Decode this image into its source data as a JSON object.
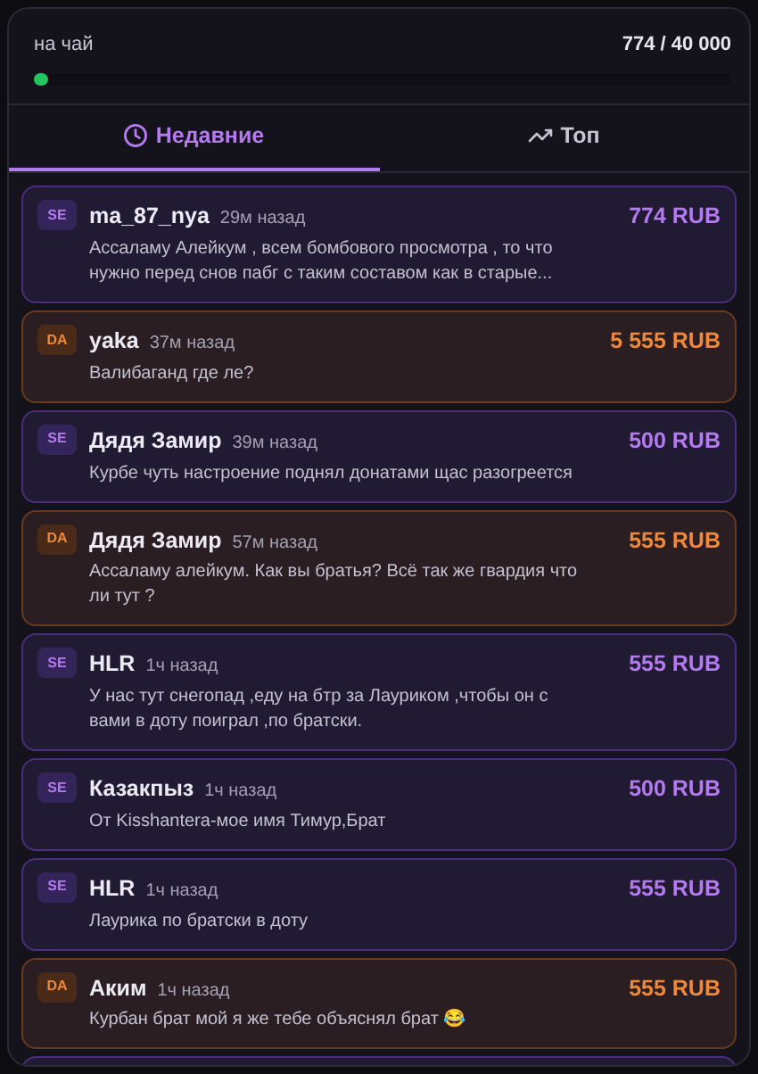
{
  "goal": {
    "title": "на чай",
    "amount": "774 / 40 000",
    "level": 0.02
  },
  "tabs": [
    {
      "label": "Недавние",
      "kind": "clock",
      "selected": true
    },
    {
      "label": "Топ",
      "kind": "trend",
      "selected": false
    }
  ],
  "donations": [
    {
      "kind": "se",
      "source": "SE",
      "name": "ma_87_nya",
      "time": "29м назад",
      "amount": "774 RUB",
      "message": "Ассаламу Алейкум , всем бомбового просмотра , то что нужно перед снов пабг с таким составом как в старые..."
    },
    {
      "kind": "da",
      "source": "DA",
      "name": "yaka",
      "time": "37м назад",
      "amount": "5 555 RUB",
      "message": "Валибаганд где ле?"
    },
    {
      "kind": "se",
      "source": "SE",
      "name": "Дядя Замир",
      "time": "39м назад",
      "amount": "500 RUB",
      "message": "Курбе чуть настроение поднял донатами щас разогреется"
    },
    {
      "kind": "da",
      "source": "DA",
      "name": "Дядя Замир",
      "time": "57м назад",
      "amount": "555 RUB",
      "message": "Ассаламу алейкум. Как вы братья? Всё так же гвардия что ли тут ?"
    },
    {
      "kind": "se",
      "source": "SE",
      "name": "HLR",
      "time": "1ч назад",
      "amount": "555 RUB",
      "message": "У нас тут снегопад ,еду на бтр за Лауриком ,чтобы он с вами в доту поиграл ,по братски."
    },
    {
      "kind": "se",
      "source": "SE",
      "name": "Казакпыз",
      "time": "1ч назад",
      "amount": "500 RUB",
      "message": "От Kisshantera-мое имя Тимур,Брат"
    },
    {
      "kind": "se",
      "source": "SE",
      "name": "HLR",
      "time": "1ч назад",
      "amount": "555 RUB",
      "message": "Лаурика по братски в доту"
    },
    {
      "kind": "da",
      "source": "DA",
      "name": "Аким",
      "time": "1ч назад",
      "amount": "555 RUB",
      "message": "Курбан брат мой я же тебе объяснял брат 😂"
    },
    {
      "kind": "se"
    }
  ]
}
